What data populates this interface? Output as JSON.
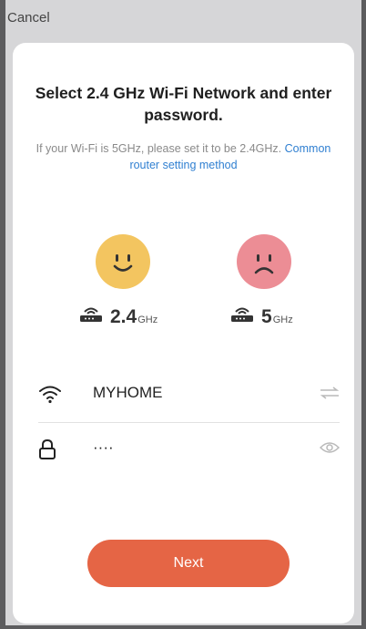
{
  "header": {
    "cancel_label": "Cancel"
  },
  "title": "Select 2.4 GHz Wi-Fi Network and enter password.",
  "subtitle": {
    "text": "If your Wi-Fi is 5GHz, please set it to be 2.4GHz.",
    "link_text": "Common router setting method"
  },
  "bands": [
    {
      "face": "happy-face-icon",
      "icon": "router-icon",
      "number": "2.4",
      "unit": "GHz",
      "face_color": "#f3c560"
    },
    {
      "face": "sad-face-icon",
      "icon": "router-icon",
      "number": "5",
      "unit": "GHz",
      "face_color": "#ec8d95"
    }
  ],
  "form": {
    "ssid": {
      "icon": "wifi-icon",
      "value": "MYHOME",
      "action_icon": "switch-network-icon"
    },
    "password": {
      "icon": "lock-icon",
      "value": "····",
      "action_icon": "eye-icon"
    }
  },
  "next_label": "Next",
  "colors": {
    "accent": "#e56545",
    "link": "#2f7fd1"
  }
}
